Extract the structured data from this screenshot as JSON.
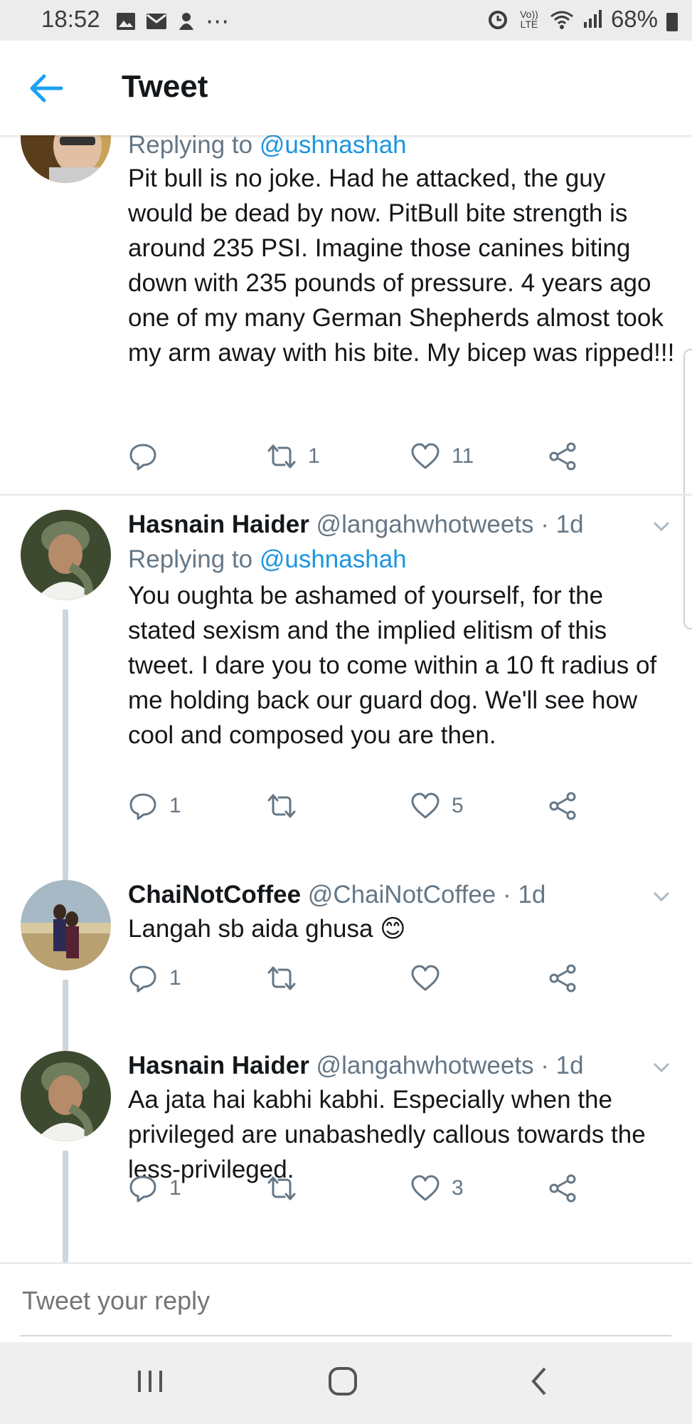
{
  "status_bar": {
    "time": "18:52",
    "battery": "68%",
    "network": "Vo)) LTE"
  },
  "header": {
    "title": "Tweet"
  },
  "tweets": [
    {
      "replying_label": "Replying to",
      "replying_to": "@ushnashah",
      "body": "Pit bull is no joke. Had he attacked, the guy would be dead by now. PitBull bite strength is around 235 PSI. Imagine those canines biting down with 235 pounds of pressure. 4 years ago one of my many German Shepherds almost took my arm away with his bite. My bicep was ripped!!!",
      "replies": "",
      "retweets": "1",
      "likes": "11"
    },
    {
      "name": "Hasnain Haider",
      "handle": "@langahwhotweets",
      "time": "· 1d",
      "replying_label": "Replying to",
      "replying_to": "@ushnashah",
      "body": "You oughta be ashamed of yourself, for the stated sexism and the implied elitism of this tweet. I dare you to come within a 10 ft radius of me holding back our guard dog. We'll see how cool and composed you are then.",
      "replies": "1",
      "retweets": "",
      "likes": "5"
    },
    {
      "name": "ChaiNotCoffee",
      "handle": "@ChaiNotCoffee",
      "time": "· 1d",
      "body": "Langah sb aida ghusa 😊",
      "replies": "1",
      "retweets": "",
      "likes": ""
    },
    {
      "name": "Hasnain Haider",
      "handle": "@langahwhotweets",
      "time": "· 1d",
      "body": "Aa jata hai kabhi kabhi. Especially when the privileged are unabashedly callous towards the less-privileged.",
      "replies": "1",
      "retweets": "",
      "likes": "3"
    }
  ],
  "reply_box": {
    "placeholder": "Tweet your reply"
  },
  "colors": {
    "accent": "#1b95e0",
    "muted": "#657786",
    "text": "#14171a"
  },
  "icons": [
    "back-arrow-icon",
    "reply-icon",
    "retweet-icon",
    "like-icon",
    "share-icon",
    "chevron-down-icon",
    "recent-apps-icon",
    "home-icon",
    "back-icon"
  ]
}
